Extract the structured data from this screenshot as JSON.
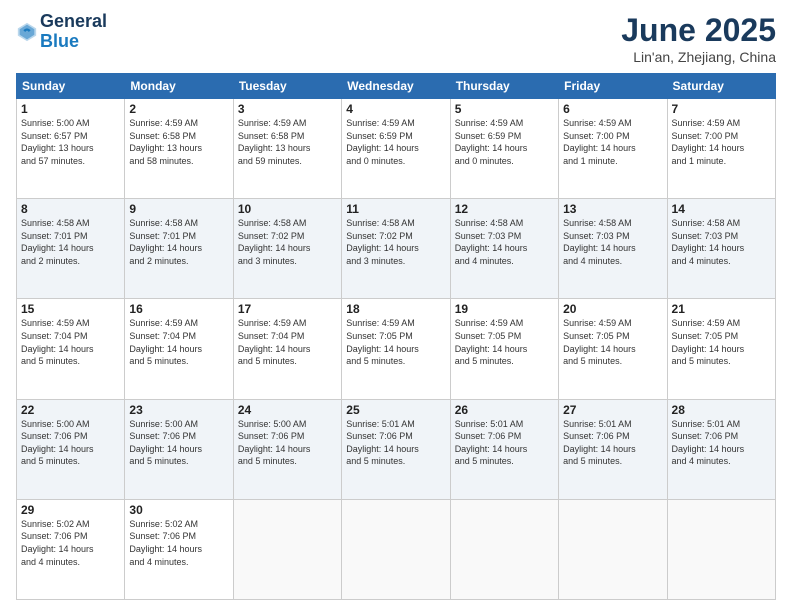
{
  "logo": {
    "general": "General",
    "blue": "Blue"
  },
  "title": "June 2025",
  "subtitle": "Lin'an, Zhejiang, China",
  "header_days": [
    "Sunday",
    "Monday",
    "Tuesday",
    "Wednesday",
    "Thursday",
    "Friday",
    "Saturday"
  ],
  "weeks": [
    [
      {
        "day": "1",
        "info": "Sunrise: 5:00 AM\nSunset: 6:57 PM\nDaylight: 13 hours\nand 57 minutes."
      },
      {
        "day": "2",
        "info": "Sunrise: 4:59 AM\nSunset: 6:58 PM\nDaylight: 13 hours\nand 58 minutes."
      },
      {
        "day": "3",
        "info": "Sunrise: 4:59 AM\nSunset: 6:58 PM\nDaylight: 13 hours\nand 59 minutes."
      },
      {
        "day": "4",
        "info": "Sunrise: 4:59 AM\nSunset: 6:59 PM\nDaylight: 14 hours\nand 0 minutes."
      },
      {
        "day": "5",
        "info": "Sunrise: 4:59 AM\nSunset: 6:59 PM\nDaylight: 14 hours\nand 0 minutes."
      },
      {
        "day": "6",
        "info": "Sunrise: 4:59 AM\nSunset: 7:00 PM\nDaylight: 14 hours\nand 1 minute."
      },
      {
        "day": "7",
        "info": "Sunrise: 4:59 AM\nSunset: 7:00 PM\nDaylight: 14 hours\nand 1 minute."
      }
    ],
    [
      {
        "day": "8",
        "info": "Sunrise: 4:58 AM\nSunset: 7:01 PM\nDaylight: 14 hours\nand 2 minutes."
      },
      {
        "day": "9",
        "info": "Sunrise: 4:58 AM\nSunset: 7:01 PM\nDaylight: 14 hours\nand 2 minutes."
      },
      {
        "day": "10",
        "info": "Sunrise: 4:58 AM\nSunset: 7:02 PM\nDaylight: 14 hours\nand 3 minutes."
      },
      {
        "day": "11",
        "info": "Sunrise: 4:58 AM\nSunset: 7:02 PM\nDaylight: 14 hours\nand 3 minutes."
      },
      {
        "day": "12",
        "info": "Sunrise: 4:58 AM\nSunset: 7:03 PM\nDaylight: 14 hours\nand 4 minutes."
      },
      {
        "day": "13",
        "info": "Sunrise: 4:58 AM\nSunset: 7:03 PM\nDaylight: 14 hours\nand 4 minutes."
      },
      {
        "day": "14",
        "info": "Sunrise: 4:58 AM\nSunset: 7:03 PM\nDaylight: 14 hours\nand 4 minutes."
      }
    ],
    [
      {
        "day": "15",
        "info": "Sunrise: 4:59 AM\nSunset: 7:04 PM\nDaylight: 14 hours\nand 5 minutes."
      },
      {
        "day": "16",
        "info": "Sunrise: 4:59 AM\nSunset: 7:04 PM\nDaylight: 14 hours\nand 5 minutes."
      },
      {
        "day": "17",
        "info": "Sunrise: 4:59 AM\nSunset: 7:04 PM\nDaylight: 14 hours\nand 5 minutes."
      },
      {
        "day": "18",
        "info": "Sunrise: 4:59 AM\nSunset: 7:05 PM\nDaylight: 14 hours\nand 5 minutes."
      },
      {
        "day": "19",
        "info": "Sunrise: 4:59 AM\nSunset: 7:05 PM\nDaylight: 14 hours\nand 5 minutes."
      },
      {
        "day": "20",
        "info": "Sunrise: 4:59 AM\nSunset: 7:05 PM\nDaylight: 14 hours\nand 5 minutes."
      },
      {
        "day": "21",
        "info": "Sunrise: 4:59 AM\nSunset: 7:05 PM\nDaylight: 14 hours\nand 5 minutes."
      }
    ],
    [
      {
        "day": "22",
        "info": "Sunrise: 5:00 AM\nSunset: 7:06 PM\nDaylight: 14 hours\nand 5 minutes."
      },
      {
        "day": "23",
        "info": "Sunrise: 5:00 AM\nSunset: 7:06 PM\nDaylight: 14 hours\nand 5 minutes."
      },
      {
        "day": "24",
        "info": "Sunrise: 5:00 AM\nSunset: 7:06 PM\nDaylight: 14 hours\nand 5 minutes."
      },
      {
        "day": "25",
        "info": "Sunrise: 5:01 AM\nSunset: 7:06 PM\nDaylight: 14 hours\nand 5 minutes."
      },
      {
        "day": "26",
        "info": "Sunrise: 5:01 AM\nSunset: 7:06 PM\nDaylight: 14 hours\nand 5 minutes."
      },
      {
        "day": "27",
        "info": "Sunrise: 5:01 AM\nSunset: 7:06 PM\nDaylight: 14 hours\nand 5 minutes."
      },
      {
        "day": "28",
        "info": "Sunrise: 5:01 AM\nSunset: 7:06 PM\nDaylight: 14 hours\nand 4 minutes."
      }
    ],
    [
      {
        "day": "29",
        "info": "Sunrise: 5:02 AM\nSunset: 7:06 PM\nDaylight: 14 hours\nand 4 minutes."
      },
      {
        "day": "30",
        "info": "Sunrise: 5:02 AM\nSunset: 7:06 PM\nDaylight: 14 hours\nand 4 minutes."
      },
      {
        "day": "",
        "info": ""
      },
      {
        "day": "",
        "info": ""
      },
      {
        "day": "",
        "info": ""
      },
      {
        "day": "",
        "info": ""
      },
      {
        "day": "",
        "info": ""
      }
    ]
  ]
}
